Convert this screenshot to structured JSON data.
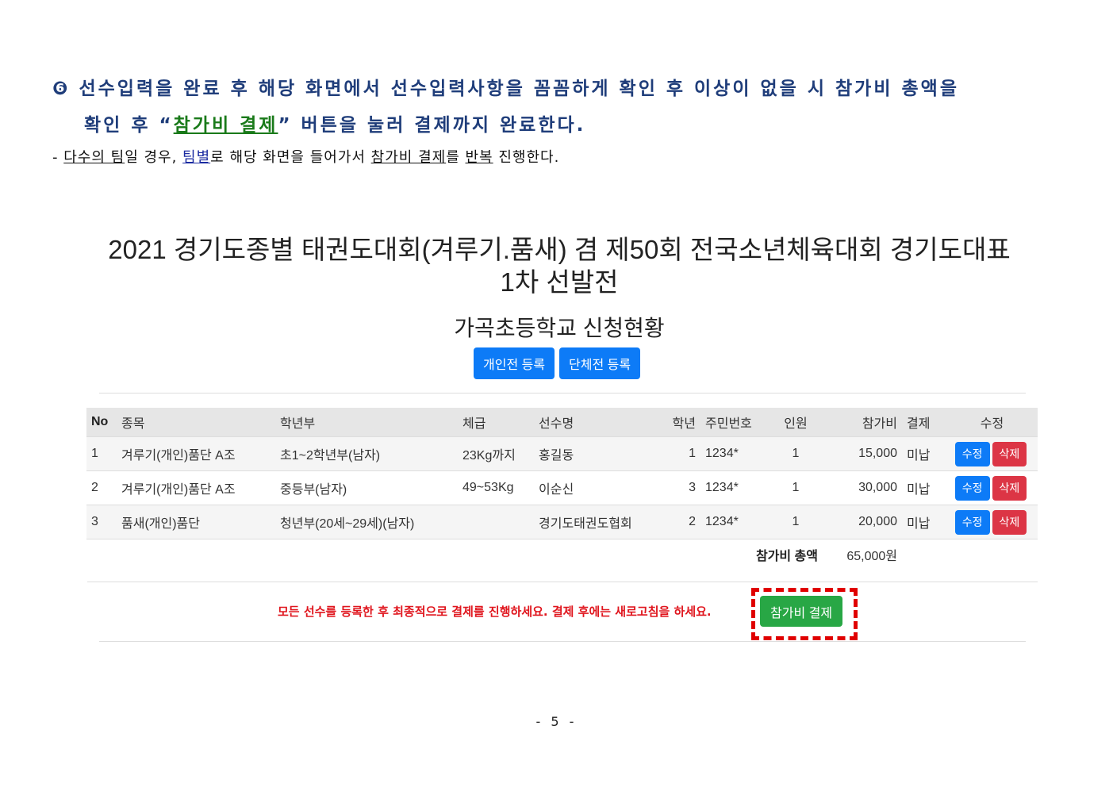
{
  "instruction": {
    "line1": "❻ 선수입력을 완료 후 해당 화면에서 선수입력사항을 꼼꼼하게 확인 후 이상이 없을 시 참가비 총액을",
    "line2_pre": "확인 후 “",
    "line2_highlight": "참가비 결제",
    "line2_post": "” 버튼을 눌러 결제까지 완료한다.",
    "line3_parts": [
      "- ",
      "다수의 팀",
      "일 경우, ",
      "팀별",
      "로 해당 화면을 들어가서 ",
      "참가비 결제",
      "를 ",
      "반복",
      " 진행한다."
    ]
  },
  "title_line1": "2021 경기도종별 태권도대회(겨루기.품새) 겸 제50회 전국소년체육대회 경기도대표",
  "title_line2": "1차 선발전",
  "subtitle": "가곡초등학교 신청현황",
  "buttons": {
    "individual": "개인전 등록",
    "team": "단체전 등록",
    "pay": "참가비 결제"
  },
  "table": {
    "headers": [
      "No",
      "종목",
      "학년부",
      "체급",
      "선수명",
      "학년",
      "주민번호",
      "인원",
      "참가비",
      "결제",
      "수정"
    ],
    "rows": [
      {
        "no": "1",
        "event": "겨루기(개인)품단 A조",
        "division": "초1~2학년부(남자)",
        "weight": "23Kg까지",
        "name": "홍길동",
        "grade": "1",
        "id": "1234*",
        "count": "1",
        "fee": "15,000",
        "pay": "미납"
      },
      {
        "no": "2",
        "event": "겨루기(개인)품단 A조",
        "division": "중등부(남자)",
        "weight": "49~53Kg",
        "name": "이순신",
        "grade": "3",
        "id": "1234*",
        "count": "1",
        "fee": "30,000",
        "pay": "미납"
      },
      {
        "no": "3",
        "event": "품새(개인)품단",
        "division": "청년부(20세~29세)(남자)",
        "weight": "",
        "name": "경기도태권도협회",
        "grade": "2",
        "id": "1234*",
        "count": "1",
        "fee": "20,000",
        "pay": "미납"
      }
    ],
    "edit_label": "수정",
    "delete_label": "삭제",
    "total_label": "참가비 총액",
    "total_value": "65,000원"
  },
  "notice": "모든 선수를 등록한 후 최종적으로 결제를 진행하세요. 결제 후에는 새로고침을 하세요.",
  "page_number": "- 5 -"
}
